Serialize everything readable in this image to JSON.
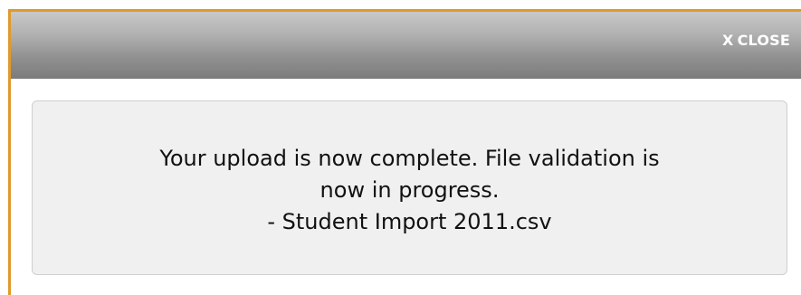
{
  "dialog": {
    "close_icon": "x-icon",
    "close_label": "CLOSE",
    "close_x": "X",
    "accent_color": "#e09a2c"
  },
  "message": {
    "line1": "Your upload is now complete. File validation is",
    "line2": "now in progress.",
    "line3": "- Student Import 2011.csv"
  }
}
